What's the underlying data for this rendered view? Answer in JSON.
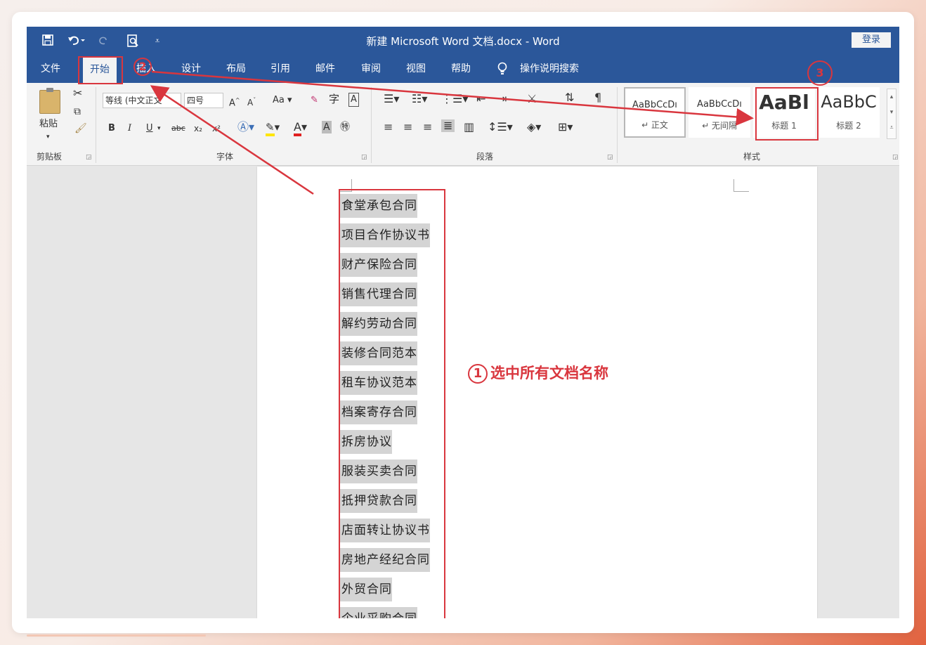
{
  "titlebar": {
    "doc_title": "新建 Microsoft Word 文档.docx  -  Word",
    "login": "登录"
  },
  "qat": {
    "undo_icon": "undo-icon",
    "redo_icon": "redo-icon",
    "save_icon": "save-icon",
    "preview_icon": "print-preview-icon"
  },
  "tabs": [
    "文件",
    "开始",
    "插入",
    "设计",
    "布局",
    "引用",
    "邮件",
    "审阅",
    "视图",
    "帮助"
  ],
  "tell_me": "操作说明搜索",
  "ribbon": {
    "clipboard": {
      "paste": "粘贴",
      "label": "剪贴板"
    },
    "font": {
      "font_name": "等线 (中文正文",
      "font_size": "四号",
      "change_case": "Aa",
      "label": "字体",
      "bold": "B",
      "italic": "I",
      "underline": "U",
      "strike": "abc",
      "subscript": "x₂",
      "superscript": "x²"
    },
    "paragraph": {
      "label": "段落"
    },
    "styles": {
      "label": "样式",
      "items": [
        {
          "sample": "AaBbCcDı",
          "name": "↵ 正文"
        },
        {
          "sample": "AaBbCcDı",
          "name": "↵ 无间隔"
        },
        {
          "sample": "AaBl",
          "name": "标题 1"
        },
        {
          "sample": "AaBbC",
          "name": "标题 2"
        }
      ]
    }
  },
  "document": {
    "lines": [
      "食堂承包合同",
      "项目合作协议书",
      "财产保险合同",
      "销售代理合同",
      "解约劳动合同",
      "装修合同范本",
      "租车协议范本",
      "档案寄存合同",
      "拆房协议",
      "服装买卖合同",
      "抵押贷款合同",
      "店面转让协议书",
      "房地产经纪合同",
      "外贸合同",
      "企业采购合同"
    ]
  },
  "annotations": {
    "step1_num": "1",
    "step1_text": "选中所有文档名称",
    "step2_num": "2",
    "step3_num": "3",
    "color": "#d9363e"
  },
  "colors": {
    "word_blue": "#2b579a",
    "ribbon_bg": "#f3f3f3",
    "selection": "#d4d4d4"
  }
}
